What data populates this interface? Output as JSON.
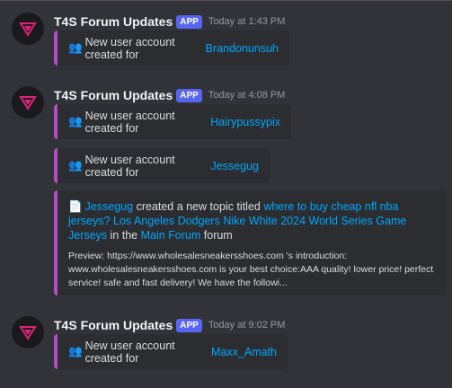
{
  "messages": [
    {
      "author": "T4S Forum Updates",
      "tag": "APP",
      "time": "Today at 1:43 PM",
      "embeds": [
        {
          "prefix": "New user account created for ",
          "link": "Brandonunsuh"
        }
      ]
    },
    {
      "author": "T4S Forum Updates",
      "tag": "APP",
      "time": "Today at 4:08 PM",
      "embeds": [
        {
          "prefix": "New user account created for ",
          "link": "Hairypussypix"
        },
        {
          "prefix": "New user account created for ",
          "link": "Jessegug"
        }
      ],
      "topic_embed": {
        "user": "Jessegug",
        "mid": " created a new topic titled ",
        "title": "where to buy cheap nfl nba jerseys? Los Angeles Dodgers Nike White 2024 World Series Game Jerseys",
        "in": " in the ",
        "forum": "Main Forum",
        "tail": " forum",
        "preview": "Preview: https://www.wholesalesneakersshoes.com 's introduction: www.wholesalesneakersshoes.com is your best choice:AAA quality! lower price! perfect service! safe and fast delivery!   We have the followi..."
      }
    },
    {
      "author": "T4S Forum Updates",
      "tag": "APP",
      "time": "Today at 9:02 PM",
      "embeds": [
        {
          "prefix": "New user account created for ",
          "link": "Maxx_Amath"
        }
      ]
    }
  ],
  "icons": {
    "avatar": "t4s-triangle-logo-icon",
    "user_add": "busts-in-silhouette-icon",
    "topic": "page-facing-up-icon"
  },
  "colors": {
    "background": "#313338",
    "embed_bg": "#2b2d31",
    "embed_border": "#b84ac6",
    "link": "#00a8fc",
    "app_tag": "#5865f2"
  }
}
